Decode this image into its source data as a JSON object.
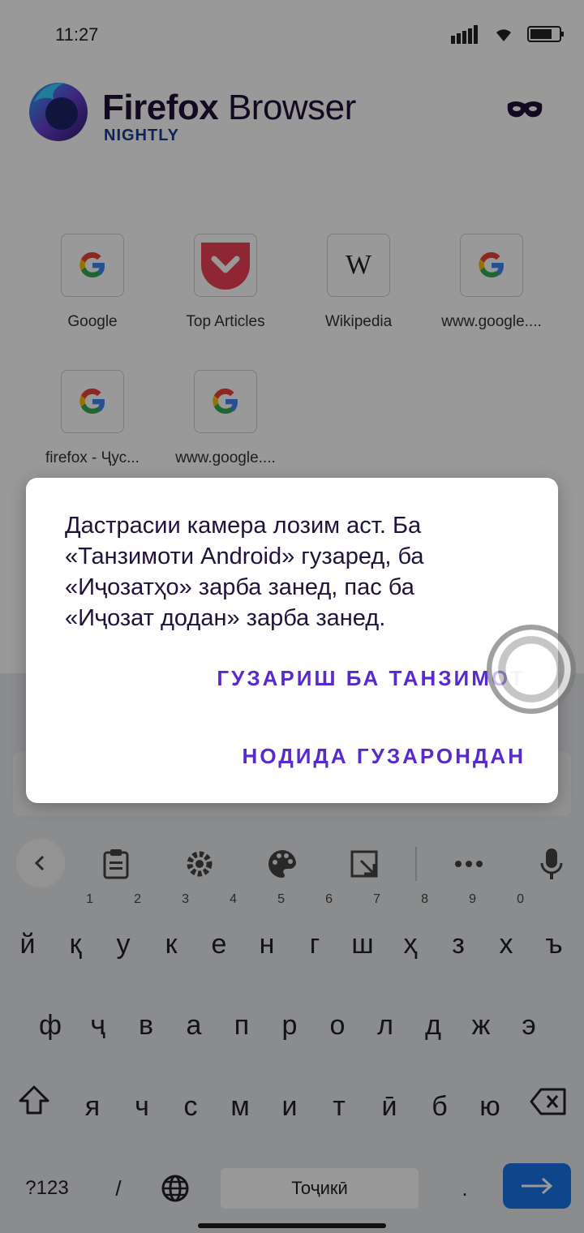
{
  "status": {
    "time": "11:27"
  },
  "header": {
    "brand_primary": "Firefox",
    "brand_secondary": "Browser",
    "channel": "NIGHTLY",
    "private_icon": "mask-icon"
  },
  "top_sites": [
    {
      "label": "Google",
      "icon": "google-icon"
    },
    {
      "label": "Top Articles",
      "icon": "pocket-icon"
    },
    {
      "label": "Wikipedia",
      "icon": "wikipedia-icon"
    },
    {
      "label": "www.google....",
      "icon": "google-icon"
    },
    {
      "label": "firefox - Ҷус...",
      "icon": "google-icon"
    },
    {
      "label": "www.google....",
      "icon": "google-icon"
    }
  ],
  "dialog": {
    "message_lines": [
      "Дастрасии камера лозим аст. Ба",
      "«Танзимоти Android» гузаред, ба",
      "«Иҷозатҳо» зарба занед, пас ба",
      "«Иҷозат додан» зарба занед."
    ],
    "positive_button": "ГУЗАРИШ БА ТАНЗИМОТ",
    "negative_button": "НОДИДА ГУЗАРОНДАН"
  },
  "keyboard": {
    "row1": [
      "й",
      "қ",
      "у",
      "к",
      "е",
      "н",
      "г",
      "ш",
      "ҳ",
      "з",
      "х",
      "ъ"
    ],
    "row1_numbers": [
      "1",
      "2",
      "3",
      "4",
      "5",
      "6",
      "7",
      "8",
      "9",
      "0"
    ],
    "row2": [
      "ф",
      "ҷ",
      "в",
      "а",
      "п",
      "р",
      "о",
      "л",
      "д",
      "ж",
      "э"
    ],
    "row3": [
      "я",
      "ч",
      "с",
      "м",
      "и",
      "т",
      "ӣ",
      "б",
      "ю"
    ],
    "symbols_key": "?123",
    "slash_key": "/",
    "space_label": "Тоҷикӣ",
    "period_key": "."
  },
  "colors": {
    "accent": "#592acb",
    "enter": "#1a73e8",
    "dim": "rgba(0,0,0,0.40)"
  }
}
